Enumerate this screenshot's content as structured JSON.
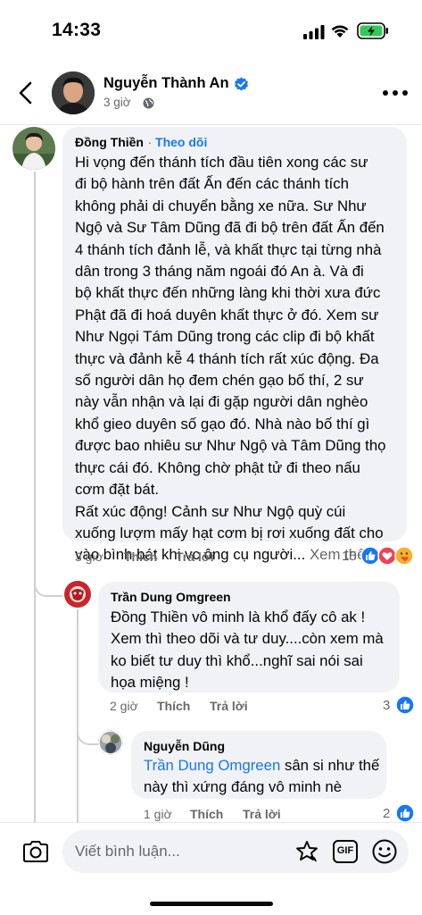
{
  "status_bar": {
    "time": "14:33"
  },
  "post": {
    "author": "Nguyễn Thành An",
    "time": "3 giờ",
    "globe_icon": "globe-icon",
    "verified_icon": "verified-badge-icon"
  },
  "comments": [
    {
      "author": "Đồng Thiền",
      "follow_label": "Theo dõi",
      "lines": [
        "Hi vọng đến thánh tích đầu tiên xong các sư",
        "đi bộ hành trên đất Ấn đến các thánh tích",
        "không phải di chuyển bằng xe nữa. Sư Như",
        "Ngộ và Sư Tâm Dũng đã đi bộ trên đất Ấn đến",
        "4 thánh tích đảnh lễ, và khất thực tại từng nhà",
        "dân trong 3 tháng năm ngoái đó An à. Và đi",
        "bộ khất thực đến những làng khi thời xưa đức",
        "Phật đã đi hoá duyên khất thực ở đó. Xem sư",
        "Như Ngọi Tám Dũng trong các clip đi bộ khất",
        "thực và đảnh kễ 4 thánh tích rất xúc động. Đa",
        "số người dân họ đem chén gạo bố thí, 2 sư",
        "này vẫn nhận và lại đi gặp người dân nghèo",
        "khổ gieo duyên số gạo đó. Nhà nào bố thí gì",
        "được bao nhiêu sư Như Ngộ  và Tâm Dũng thọ",
        "thực cái đó. Không chờ phật tử đi theo nấu",
        "cơm đặt bát.",
        "Rất xúc động! Cảnh sư Như Ngộ quỳ cúi",
        "xuống lượm mấy hạt cơm bị rơi xuống đất cho",
        "vào bình bát khi vc ông cụ người..."
      ],
      "see_more": "Xem thêm",
      "time": "3 giờ",
      "like_label": "Thích",
      "reply_label": "Trả lời",
      "reaction_count": "15"
    },
    {
      "author": "Trần Dung Omgreen",
      "lines": [
        "Đồng Thiền vô minh là khổ đấy cô ak !",
        "Xem thì theo dõi và tư duy....còn xem mà",
        "ko biết tư duy thì khổ...nghĩ sai nói sai",
        "họa miệng !"
      ],
      "time": "2 giờ",
      "like_label": "Thích",
      "reply_label": "Trả lời",
      "reaction_count": "3"
    },
    {
      "author": "Nguyễn Dũng",
      "mention": "Trần Dung Omgreen",
      "line1_rest": " sân si như thế",
      "line2": "này thì xứng đáng vô minh nè",
      "time": "1 giờ",
      "like_label": "Thích",
      "reply_label": "Trả lời",
      "reaction_count": "2"
    }
  ],
  "composer": {
    "placeholder": "Viết bình luận...",
    "gif_label": "GIF"
  },
  "colors": {
    "brand_blue": "#1877f2",
    "bubble_bg": "#f0f2f5",
    "secondary_text": "#65676b",
    "love_red": "#f33e58",
    "care_yellow": "#f7b125"
  }
}
